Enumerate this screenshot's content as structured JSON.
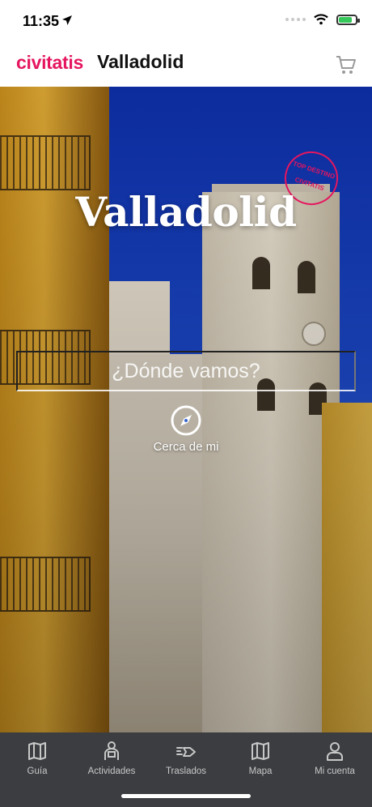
{
  "status_bar": {
    "time": "11:35"
  },
  "header": {
    "brand": "civitatis",
    "city": "Valladolid"
  },
  "hero": {
    "title": "Valladolid",
    "stamp": {
      "line1": "TOP DESTINO",
      "line2": "CIVITATIS"
    },
    "search_placeholder": "¿Dónde vamos?",
    "near_me_label": "Cerca de mi"
  },
  "tabbar": {
    "items": [
      {
        "label": "Guía",
        "icon": "map-book-icon"
      },
      {
        "label": "Actividades",
        "icon": "activities-icon"
      },
      {
        "label": "Traslados",
        "icon": "transfers-icon"
      },
      {
        "label": "Mapa",
        "icon": "map-icon"
      },
      {
        "label": "Mi cuenta",
        "icon": "user-icon"
      }
    ]
  },
  "colors": {
    "brand": "#e5165f",
    "tabbar_bg": "#3b3d40"
  }
}
